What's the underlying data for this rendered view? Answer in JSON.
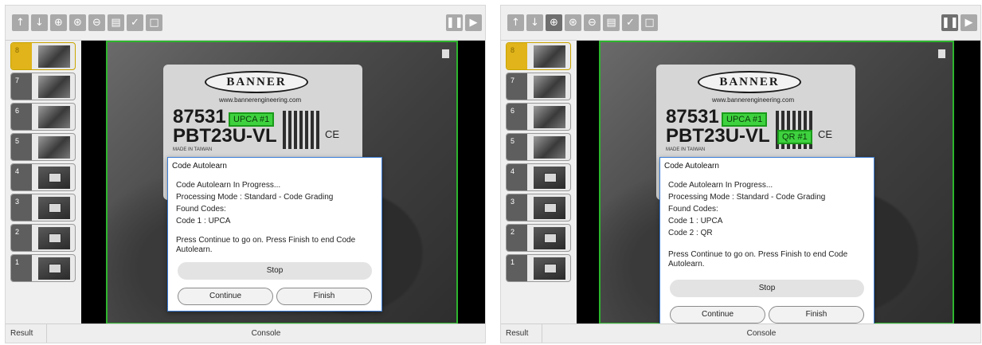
{
  "toolbar_icons": [
    "arrow-up-icon",
    "arrow-down-icon",
    "zoom-in-icon",
    "zoom-fit-icon",
    "zoom-out-icon",
    "save-image-icon",
    "check-image-icon",
    "frame-icon",
    "pause-icon",
    "play-step-icon"
  ],
  "frames": [
    "8",
    "7",
    "6",
    "5",
    "4",
    "3",
    "2",
    "1"
  ],
  "label": {
    "brand": "BANNER",
    "website": "www.bannerengineering.com",
    "part_number": "87531",
    "model": "PBT23U-VL",
    "made_in": "MADE IN TAIWAN",
    "ce": "CE"
  },
  "panels": [
    {
      "codes_found": [
        {
          "box_label": "UPCA #1"
        }
      ],
      "dialog": {
        "title": "Code Autolearn",
        "status": "Code Autolearn In Progress...",
        "mode": "Processing Mode : Standard - Code Grading",
        "found_label": "Found Codes:",
        "codes": [
          "Code 1 : UPCA"
        ],
        "message": "Press Continue to go on. Press Finish to end Code Autolearn.",
        "stop": "Stop",
        "continue": "Continue",
        "finish": "Finish"
      },
      "tabs": {
        "result": "Result",
        "console": "Console"
      }
    },
    {
      "codes_found": [
        {
          "box_label": "UPCA #1"
        },
        {
          "box_label": "QR #1"
        }
      ],
      "dialog": {
        "title": "Code Autolearn",
        "status": "Code Autolearn In Progress...",
        "mode": "Processing Mode : Standard - Code Grading",
        "found_label": "Found Codes:",
        "codes": [
          "Code 1 : UPCA",
          "Code 2 : QR"
        ],
        "message": "Press Continue to go on. Press Finish to end Code Autolearn.",
        "stop": "Stop",
        "continue": "Continue",
        "finish": "Finish"
      },
      "tabs": {
        "result": "Result",
        "console": "Console"
      }
    }
  ],
  "colors": {
    "selection": "#e0b41a",
    "roi": "#2db52d",
    "found_code": "#3fd23f",
    "dialog_border": "#3a7bd5"
  }
}
